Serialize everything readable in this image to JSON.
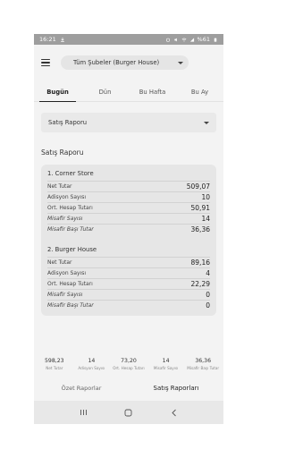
{
  "status_bar": {
    "time": "16:21",
    "battery": "%61"
  },
  "header": {
    "branch_selector": "Tüm Şubeler (Burger House)",
    "icons": {
      "menu": "hamburger-icon",
      "dropdown": "caret-down-icon"
    }
  },
  "tabs": [
    {
      "label": "Bugün",
      "active": true
    },
    {
      "label": "Dün",
      "active": false
    },
    {
      "label": "Bu Hafta",
      "active": false
    },
    {
      "label": "Bu Ay",
      "active": false
    }
  ],
  "report_selector": {
    "value": "Satış Raporu"
  },
  "section_title": "Satış Raporu",
  "branches": [
    {
      "title": "1. Corner Store",
      "rows": [
        {
          "label": "Net Tutar",
          "value": "509,07",
          "italic": false
        },
        {
          "label": "Adisyon Sayısı",
          "value": "10",
          "italic": false
        },
        {
          "label": "Ort. Hesap Tutarı",
          "value": "50,91",
          "italic": false
        },
        {
          "label": "Misafir Sayısı",
          "value": "14",
          "italic": true
        },
        {
          "label": "Misafir Başı Tutar",
          "value": "36,36",
          "italic": true
        }
      ]
    },
    {
      "title": "2. Burger House",
      "rows": [
        {
          "label": "Net Tutar",
          "value": "89,16",
          "italic": false
        },
        {
          "label": "Adisyon Sayısı",
          "value": "4",
          "italic": false
        },
        {
          "label": "Ort. Hesap Tutarı",
          "value": "22,29",
          "italic": false
        },
        {
          "label": "Misafir Sayısı",
          "value": "0",
          "italic": true
        },
        {
          "label": "Misafir Başı Tutar",
          "value": "0",
          "italic": true
        }
      ]
    }
  ],
  "summary": [
    {
      "value": "598,23",
      "label": "Net Tutar"
    },
    {
      "value": "14",
      "label": "Adisyon Sayısı"
    },
    {
      "value": "73,20",
      "label": "Ort. Hesap Tutarı"
    },
    {
      "value": "14",
      "label": "Misafir Sayısı"
    },
    {
      "value": "36,36",
      "label": "Misafir Başı Tutar"
    }
  ],
  "bottom_tabs": [
    {
      "label": "Özet Raporlar",
      "active": false
    },
    {
      "label": "Satış Raporları",
      "active": true
    }
  ],
  "nav_bar": {
    "icons": [
      "recents-icon",
      "home-icon",
      "back-icon"
    ]
  }
}
